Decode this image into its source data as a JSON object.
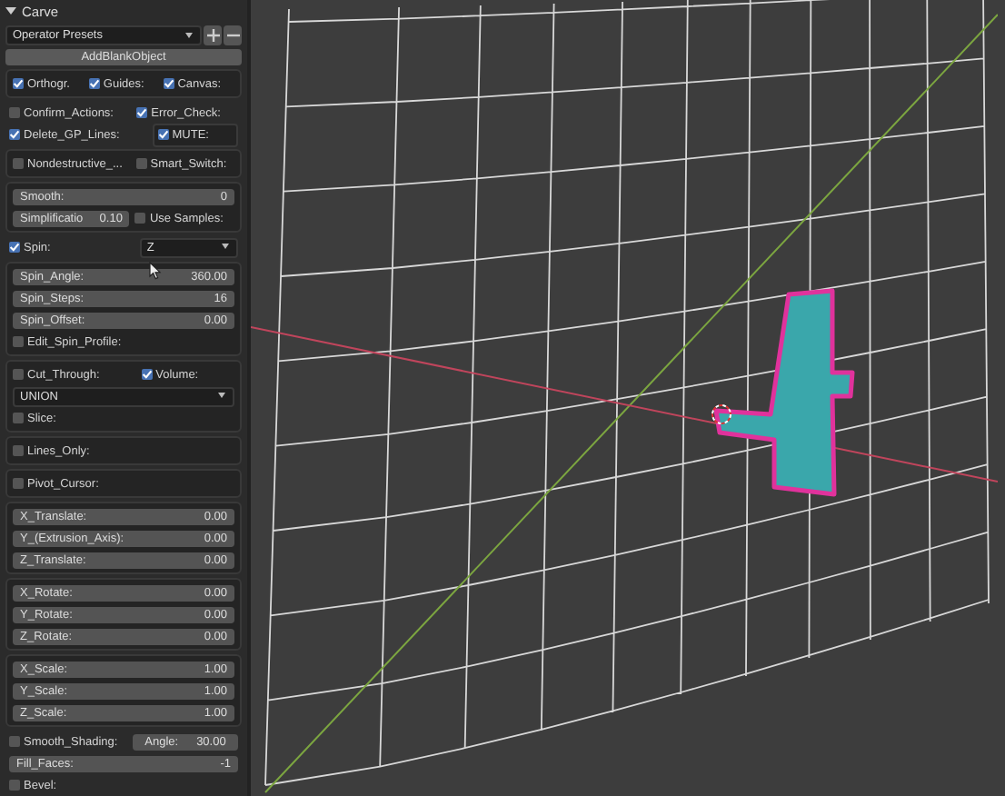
{
  "panel": {
    "title": "Carve",
    "expanded": true
  },
  "presets": {
    "label": "Operator Presets"
  },
  "add_button": "AddBlankObject",
  "sections": [
    {
      "boxed": true,
      "rows": [
        {
          "cells": [
            {
              "kind": "check",
              "label": "Orthogr.",
              "checked": true
            },
            {
              "kind": "check",
              "label": "Guides:",
              "checked": true
            },
            {
              "kind": "check",
              "label": "Canvas:",
              "checked": true
            }
          ]
        }
      ]
    },
    {
      "boxed": false,
      "rows": [
        {
          "cells": [
            {
              "kind": "check",
              "label": "Confirm_Actions:",
              "checked": false
            },
            {
              "kind": "check",
              "label": "Error_Check:",
              "checked": true
            }
          ]
        },
        {
          "cells": [
            {
              "kind": "check",
              "label": "Delete_GP_Lines:",
              "checked": true
            },
            {
              "kind": "check",
              "label": "MUTE:",
              "checked": true,
              "boxed": true
            }
          ]
        }
      ]
    },
    {
      "boxed": true,
      "rows": [
        {
          "cells": [
            {
              "kind": "check",
              "label": "Nondestructive_...",
              "checked": false
            },
            {
              "kind": "check",
              "label": "Smart_Switch:",
              "checked": false
            }
          ]
        }
      ]
    },
    {
      "boxed": true,
      "rows": [
        {
          "cells": [
            {
              "kind": "slider",
              "label": "Smooth:",
              "value": "0"
            }
          ]
        },
        {
          "cells": [
            {
              "kind": "slider",
              "label": "Simplificatio",
              "value": "0.10"
            },
            {
              "kind": "check",
              "label": "Use Samples:",
              "checked": false
            }
          ]
        }
      ]
    },
    {
      "boxed": false,
      "rows": [
        {
          "cells": [
            {
              "kind": "check",
              "label": "Spin:",
              "checked": true
            },
            {
              "kind": "dropdown",
              "value": "Z"
            }
          ]
        }
      ]
    },
    {
      "boxed": true,
      "rows": [
        {
          "cells": [
            {
              "kind": "slider",
              "label": "Spin_Angle:",
              "value": "360.00"
            }
          ]
        },
        {
          "cells": [
            {
              "kind": "slider",
              "label": "Spin_Steps:",
              "value": "16"
            }
          ]
        },
        {
          "cells": [
            {
              "kind": "slider",
              "label": "Spin_Offset:",
              "value": "0.00"
            }
          ]
        },
        {
          "cells": [
            {
              "kind": "check",
              "label": "Edit_Spin_Profile:",
              "checked": false
            }
          ]
        }
      ]
    },
    {
      "boxed": true,
      "rows": [
        {
          "cells": [
            {
              "kind": "check",
              "label": "Cut_Through:",
              "checked": false
            },
            {
              "kind": "check",
              "label": "Volume:",
              "checked": true
            }
          ]
        },
        {
          "cells": [
            {
              "kind": "dropdown",
              "value": "UNION"
            }
          ]
        },
        {
          "cells": [
            {
              "kind": "check",
              "label": "Slice:",
              "checked": false
            }
          ]
        }
      ]
    },
    {
      "boxed": true,
      "rows": [
        {
          "cells": [
            {
              "kind": "check",
              "label": "Lines_Only:",
              "checked": false
            }
          ]
        }
      ]
    },
    {
      "boxed": true,
      "rows": [
        {
          "cells": [
            {
              "kind": "check",
              "label": "Pivot_Cursor:",
              "checked": false
            }
          ]
        }
      ]
    },
    {
      "boxed": true,
      "rows": [
        {
          "cells": [
            {
              "kind": "slider",
              "label": "X_Translate:",
              "value": "0.00"
            }
          ]
        },
        {
          "cells": [
            {
              "kind": "slider",
              "label": "Y_(Extrusion_Axis):",
              "value": "0.00"
            }
          ]
        },
        {
          "cells": [
            {
              "kind": "slider",
              "label": "Z_Translate:",
              "value": "0.00"
            }
          ]
        }
      ]
    },
    {
      "boxed": true,
      "rows": [
        {
          "cells": [
            {
              "kind": "slider",
              "label": "X_Rotate:",
              "value": "0.00"
            }
          ]
        },
        {
          "cells": [
            {
              "kind": "slider",
              "label": "Y_Rotate:",
              "value": "0.00"
            }
          ]
        },
        {
          "cells": [
            {
              "kind": "slider",
              "label": "Z_Rotate:",
              "value": "0.00"
            }
          ]
        }
      ]
    },
    {
      "boxed": true,
      "rows": [
        {
          "cells": [
            {
              "kind": "slider",
              "label": "X_Scale:",
              "value": "1.00"
            }
          ]
        },
        {
          "cells": [
            {
              "kind": "slider",
              "label": "Y_Scale:",
              "value": "1.00"
            }
          ]
        },
        {
          "cells": [
            {
              "kind": "slider",
              "label": "Z_Scale:",
              "value": "1.00"
            }
          ]
        }
      ]
    },
    {
      "boxed": false,
      "rows": [
        {
          "cells": [
            {
              "kind": "check",
              "label": "Smooth_Shading:",
              "checked": false
            },
            {
              "kind": "slider",
              "label": "Angle:",
              "value": "30.00",
              "centered": true
            }
          ]
        },
        {
          "cells": [
            {
              "kind": "slider",
              "label": "Fill_Faces:",
              "value": "-1"
            }
          ]
        },
        {
          "cells": [
            {
              "kind": "check",
              "label": "Bevel:",
              "checked": false
            }
          ]
        }
      ]
    }
  ]
}
